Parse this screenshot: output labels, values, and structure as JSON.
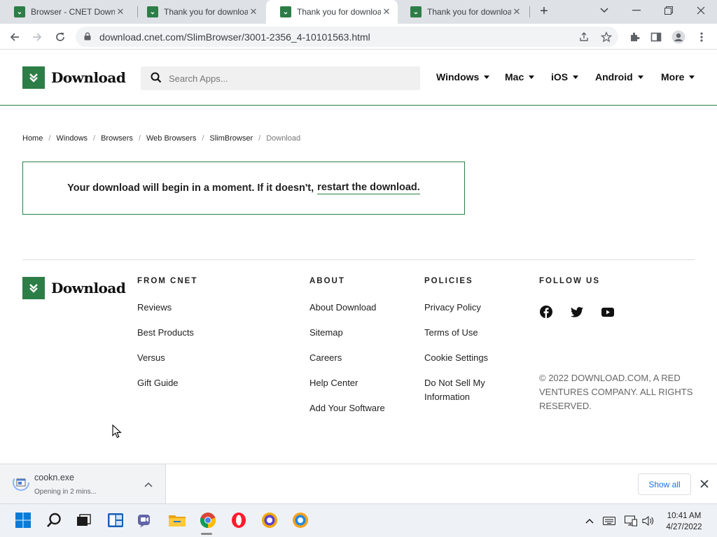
{
  "browser": {
    "tabs": [
      {
        "title": "Browser - CNET Download",
        "favicon": "download-favicon",
        "active": false
      },
      {
        "title": "Thank you for downloading",
        "favicon": "download-favicon",
        "active": false
      },
      {
        "title": "Thank you for downloading",
        "favicon": "download-favicon",
        "active": true
      },
      {
        "title": "Thank you for downloading",
        "favicon": "download-favicon",
        "active": false
      }
    ],
    "url": "download.cnet.com/SlimBrowser/3001-2356_4-10101563.html"
  },
  "site": {
    "brand_color": "#2d7d46",
    "logo_text": "Download",
    "search_placeholder": "Search Apps...",
    "nav": [
      "Windows",
      "Mac",
      "iOS",
      "Android",
      "More"
    ]
  },
  "breadcrumb": [
    "Home",
    "Windows",
    "Browsers",
    "Web Browsers",
    "SlimBrowser",
    "Download"
  ],
  "notice": {
    "text": "Your download will begin in a moment. If it doesn't,",
    "link": "restart the download."
  },
  "footer": {
    "logo_text": "Download",
    "columns": [
      {
        "heading": "FROM CNET",
        "links": [
          "Reviews",
          "Best Products",
          "Versus",
          "Gift Guide"
        ]
      },
      {
        "heading": "ABOUT",
        "links": [
          "About Download",
          "Sitemap",
          "Careers",
          "Help Center",
          "Add Your Software"
        ]
      },
      {
        "heading": "POLICIES",
        "links": [
          "Privacy Policy",
          "Terms of Use",
          "Cookie Settings",
          "Do Not Sell My Information"
        ]
      },
      {
        "heading": "FOLLOW US",
        "social": [
          "facebook-icon",
          "twitter-icon",
          "youtube-icon"
        ]
      }
    ],
    "copyright": "© 2022 DOWNLOAD.COM, A RED VENTURES COMPANY. ALL RIGHTS RESERVED."
  },
  "download_shelf": {
    "file_name": "cookn.exe",
    "status": "Opening in 2 mins...",
    "show_all": "Show all"
  },
  "taskbar": {
    "apps": [
      "windows-start-icon",
      "search-icon",
      "task-view-icon",
      "widgets-icon",
      "teams-chat-icon",
      "file-explorer-icon",
      "chrome-icon",
      "opera-icon",
      "browser-a-icon",
      "browser-b-icon"
    ],
    "time": "10:41 AM",
    "date": "4/27/2022"
  }
}
